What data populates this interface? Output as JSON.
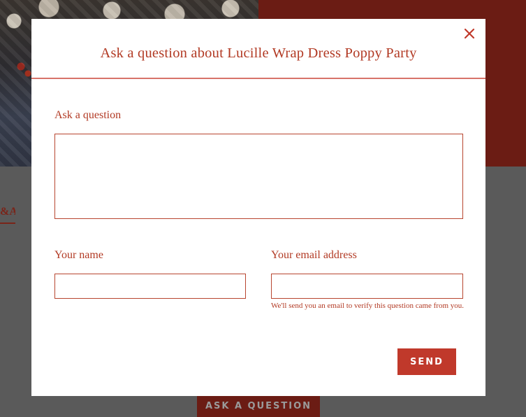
{
  "background": {
    "tab_fragment": "&A",
    "ask_button_label": "ASK A QUESTION"
  },
  "modal": {
    "title": "Ask a question about Lucille Wrap Dress Poppy Party",
    "close_icon": "close-icon",
    "question_label": "Ask a question",
    "question_value": "",
    "name_label": "Your name",
    "name_value": "",
    "email_label": "Your email address",
    "email_value": "",
    "email_hint": "We'll send you an email to verify this question came from you.",
    "send_label": "SEND"
  },
  "colors": {
    "accent": "#b23a24",
    "button": "#c0392b",
    "overlay": "#5a5a5a"
  }
}
